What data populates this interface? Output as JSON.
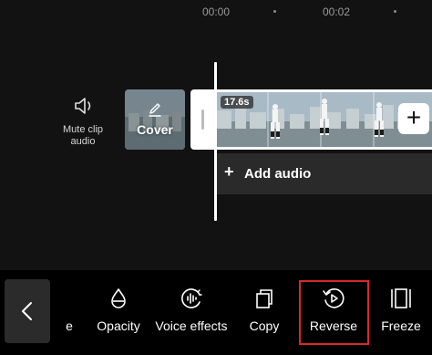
{
  "ruler": {
    "time_start": "00:00",
    "time_next": "00:02"
  },
  "track": {
    "mute_label": "Mute clip audio",
    "cover_label": "Cover",
    "clip_duration": "17.6s",
    "add_clip_symbol": "+",
    "add_audio_symbol": "+",
    "add_audio_label": "Add audio"
  },
  "toolbar": {
    "partial_label": "e",
    "opacity_label": "Opacity",
    "voice_effects_label": "Voice effects",
    "copy_label": "Copy",
    "reverse_label": "Reverse",
    "freeze_label": "Freeze"
  },
  "colors": {
    "background": "#121212",
    "toolbar_background": "#000000",
    "highlight": "#d9282b",
    "audio_track": "#2a2a2a"
  }
}
